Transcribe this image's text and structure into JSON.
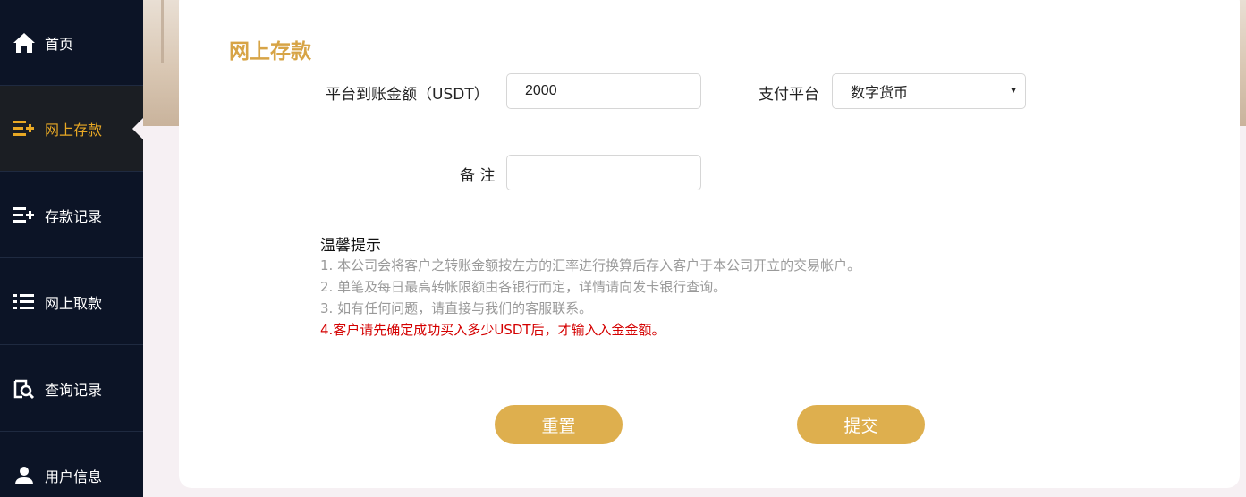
{
  "sidebar": {
    "items": [
      {
        "label": "首页",
        "icon": "home-icon"
      },
      {
        "label": "网上存款",
        "icon": "deposit-list-icon",
        "active": true
      },
      {
        "label": "存款记录",
        "icon": "deposit-record-icon"
      },
      {
        "label": "网上取款",
        "icon": "withdraw-list-icon"
      },
      {
        "label": "查询记录",
        "icon": "search-record-icon"
      },
      {
        "label": "用户信息",
        "icon": "user-icon"
      }
    ]
  },
  "page": {
    "title": "网上存款"
  },
  "form": {
    "amount_label": "平台到账金额（USDT）",
    "amount_value": "2000",
    "platform_label": "支付平台",
    "platform_value": "数字货币",
    "note_label": "备 注",
    "note_value": ""
  },
  "tips": {
    "title": "温馨提示",
    "lines": [
      "1. 本公司会将客户之转账金额按左方的汇率进行换算后存入客户于本公司开立的交易帐户。",
      "2. 单笔及每日最高转帐限额由各银行而定，详情请向发卡银行查询。",
      "3. 如有任何问题，请直接与我们的客服联系。",
      "4.客户请先确定成功买入多少USDT后，才输入入金金额。"
    ]
  },
  "buttons": {
    "reset": "重置",
    "submit": "提交"
  },
  "colors": {
    "accent": "#deaf4e",
    "title": "#d7a446",
    "active_nav": "#e8a824",
    "sidebar_bg": "#0c1426",
    "warning": "#d40000"
  }
}
